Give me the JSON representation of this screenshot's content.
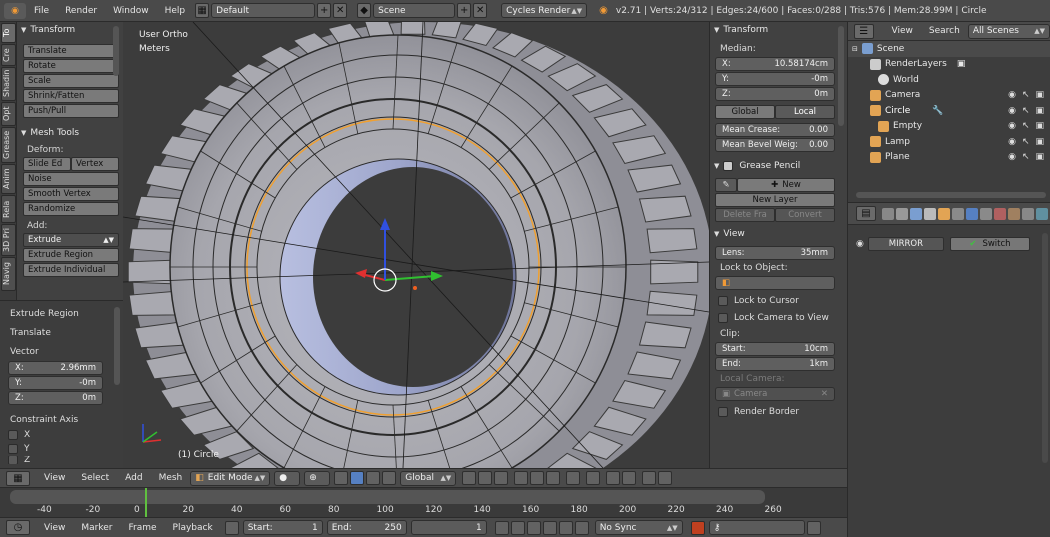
{
  "topbar": {
    "menus": [
      "File",
      "Render",
      "Window",
      "Help"
    ],
    "layout": "Default",
    "scene": "Scene",
    "engine": "Cycles Render",
    "stats": "v2.71 | Verts:24/312 | Edges:24/600 | Faces:0/288 | Tris:576 | Mem:28.99M | Circle"
  },
  "tabstrip": [
    "To",
    "Cre",
    "Shadin",
    "Opt",
    "Grease",
    "Anim",
    "Rela",
    "3D Pri",
    "Navig"
  ],
  "toolshelf": {
    "transform_title": "Transform",
    "transform_tools": [
      "Translate",
      "Rotate",
      "Scale",
      "Shrink/Fatten",
      "Push/Pull"
    ],
    "mesh_title": "Mesh Tools",
    "deform_label": "Deform:",
    "deform_row": [
      "Slide Ed",
      "Vertex"
    ],
    "deform_tools": [
      "Noise",
      "Smooth Vertex",
      "Randomize"
    ],
    "add_label": "Add:",
    "extrude": "Extrude",
    "add_tools": [
      "Extrude Region",
      "Extrude Individual"
    ]
  },
  "redo": {
    "op_title": "Extrude Region",
    "op_sub": "Translate",
    "vector_label": "Vector",
    "x_label": "X:",
    "x_val": "2.96mm",
    "y_label": "Y:",
    "y_val": "-0m",
    "z_label": "Z:",
    "z_val": "0m",
    "constraint_label": "Constraint Axis",
    "axes": [
      "X",
      "Y",
      "Z"
    ]
  },
  "viewport": {
    "view_name": "User Ortho",
    "units": "Meters",
    "object_label": "(1) Circle"
  },
  "npanel": {
    "transform_title": "Transform",
    "median_label": "Median:",
    "x_label": "X:",
    "x_val": "10.58174cm",
    "y_label": "Y:",
    "y_val": "-0m",
    "z_label": "Z:",
    "z_val": "0m",
    "global": "Global",
    "local": "Local",
    "crease_label": "Mean Crease:",
    "crease_val": "0.00",
    "bevel_label": "Mean Bevel Weig:",
    "bevel_val": "0.00",
    "grease_title": "Grease Pencil",
    "new_btn": "New",
    "new_layer": "New Layer",
    "delete_frame": "Delete Fra",
    "convert": "Convert",
    "view_title": "View",
    "lens_label": "Lens:",
    "lens_val": "35mm",
    "lock_obj_label": "Lock to Object:",
    "lock_cursor": "Lock to Cursor",
    "lock_camera": "Lock Camera to View",
    "clip_label": "Clip:",
    "start_label": "Start:",
    "start_val": "10cm",
    "end_label": "End:",
    "end_val": "1km",
    "local_camera_label": "Local Camera:",
    "camera_field": "Camera",
    "render_border": "Render Border"
  },
  "outliner": {
    "view": "View",
    "search": "Search",
    "scope": "All Scenes",
    "items": [
      "Scene",
      "RenderLayers",
      "World",
      "Camera",
      "Circle",
      "Empty",
      "Lamp",
      "Plane"
    ]
  },
  "props": {
    "modifier_name": "MIRROR",
    "switch_label": "Switch"
  },
  "vp_header": {
    "menus": [
      "View",
      "Select",
      "Add",
      "Mesh"
    ],
    "mode": "Edit Mode",
    "orientation": "Global"
  },
  "timeline": {
    "ticks": [
      "-40",
      "-20",
      "0",
      "20",
      "40",
      "60",
      "80",
      "100",
      "120",
      "140",
      "160",
      "180",
      "200",
      "220",
      "240",
      "260"
    ],
    "current_frame": 1
  },
  "tl_header": {
    "menus": [
      "View",
      "Marker",
      "Frame",
      "Playback"
    ],
    "start_label": "Start:",
    "start_val": "1",
    "end_label": "End:",
    "end_val": "250",
    "frame_val": "1",
    "sync": "No Sync"
  },
  "colors": {
    "accent_orange": "#f19a36",
    "selection_blue": "#5680c2",
    "header_gray": "#4a4a4a"
  }
}
